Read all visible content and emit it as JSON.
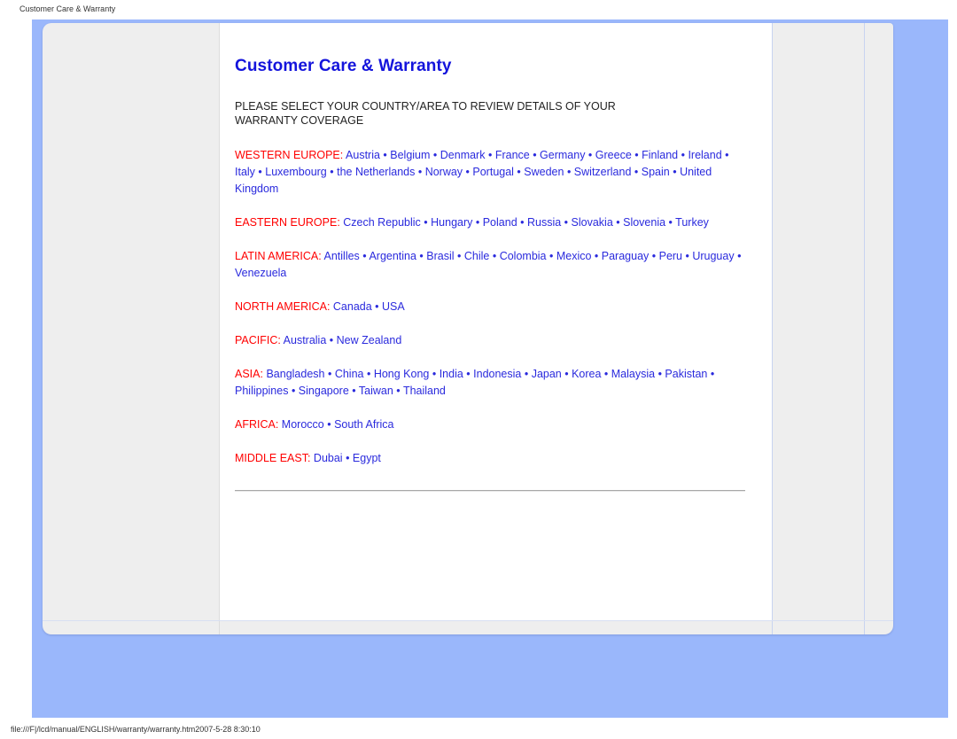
{
  "browser": {
    "title": "Customer Care & Warranty",
    "status_path": "file:///F|/lcd/manual/ENGLISH/warranty/warranty.htm2007-5-28 8:30:10"
  },
  "colors": {
    "title_blue": "#1414dc",
    "region_red": "#ff0000",
    "link_blue": "#2a2add",
    "page_blue": "#9ab7fb",
    "frame_gray": "#eeeeee"
  },
  "page": {
    "title": "Customer Care & Warranty",
    "intro": "PLEASE SELECT YOUR COUNTRY/AREA TO REVIEW DETAILS OF YOUR WARRANTY COVERAGE",
    "separator": ":",
    "bullet": "•",
    "regions": [
      {
        "name": "WESTERN EUROPE",
        "countries": [
          "Austria",
          "Belgium",
          "Denmark",
          "France",
          "Germany",
          "Greece",
          "Finland",
          "Ireland",
          "Italy",
          "Luxembourg",
          "the Netherlands",
          "Norway",
          "Portugal",
          "Sweden",
          "Switzerland",
          "Spain",
          "United Kingdom"
        ]
      },
      {
        "name": "EASTERN EUROPE",
        "countries": [
          "Czech Republic",
          "Hungary",
          "Poland",
          "Russia",
          "Slovakia",
          "Slovenia",
          "Turkey"
        ]
      },
      {
        "name": "LATIN AMERICA",
        "countries": [
          "Antilles",
          "Argentina",
          "Brasil",
          "Chile",
          "Colombia",
          "Mexico",
          "Paraguay",
          "Peru",
          "Uruguay",
          "Venezuela"
        ]
      },
      {
        "name": "NORTH AMERICA",
        "countries": [
          "Canada",
          "USA"
        ]
      },
      {
        "name": "PACIFIC",
        "countries": [
          "Australia",
          "New Zealand"
        ]
      },
      {
        "name": "ASIA",
        "countries": [
          "Bangladesh",
          "China",
          "Hong Kong",
          "India",
          "Indonesia",
          "Japan",
          "Korea",
          "Malaysia",
          "Pakistan",
          "Philippines",
          "Singapore",
          "Taiwan",
          "Thailand"
        ]
      },
      {
        "name": "AFRICA",
        "countries": [
          "Morocco",
          "South Africa"
        ]
      },
      {
        "name": "MIDDLE EAST",
        "countries": [
          "Dubai",
          "Egypt"
        ]
      }
    ]
  }
}
